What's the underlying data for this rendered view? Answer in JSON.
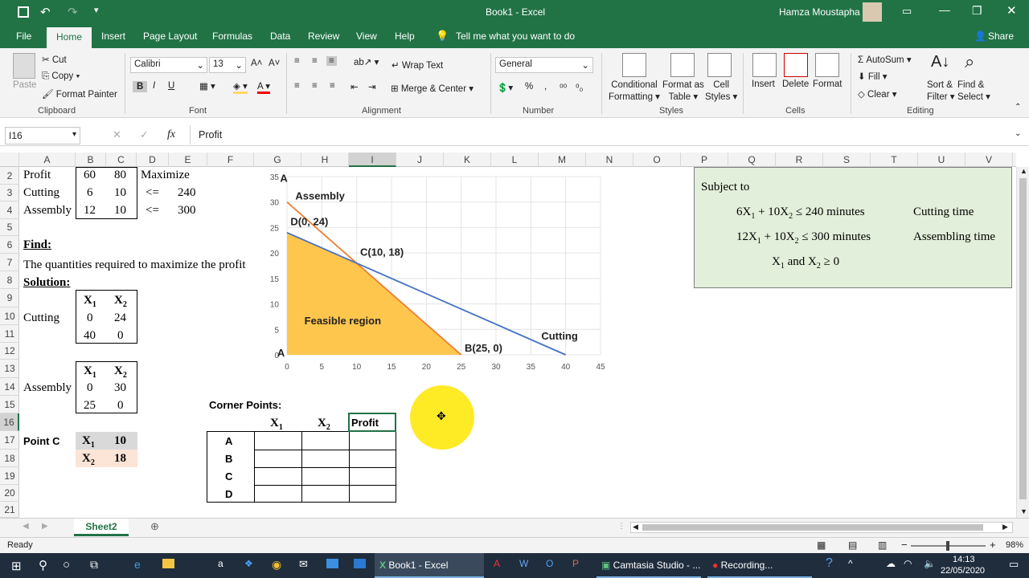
{
  "titlebar": {
    "title": "Book1  -  Excel",
    "user": "Hamza Moustapha"
  },
  "tabs": [
    "File",
    "Home",
    "Insert",
    "Page Layout",
    "Formulas",
    "Data",
    "Review",
    "View",
    "Help"
  ],
  "tell_me": "Tell me what you want to do",
  "share": "Share",
  "ribbon": {
    "clipboard": {
      "paste": "Paste",
      "cut": "Cut",
      "copy": "Copy",
      "format_painter": "Format Painter",
      "label": "Clipboard"
    },
    "font": {
      "name": "Calibri",
      "size": "13",
      "label": "Font"
    },
    "alignment": {
      "wrap": "Wrap Text",
      "merge": "Merge & Center",
      "label": "Alignment"
    },
    "number": {
      "format": "General",
      "label": "Number"
    },
    "styles": {
      "cond": "Conditional",
      "cond2": "Formatting",
      "fmt_table": "Format as",
      "fmt_table2": "Table",
      "cell_styles": "Cell",
      "cell_styles2": "Styles",
      "label": "Styles"
    },
    "cells": {
      "insert": "Insert",
      "delete": "Delete",
      "format": "Format",
      "label": "Cells"
    },
    "editing": {
      "autosum": "AutoSum",
      "fill": "Fill",
      "clear": "Clear",
      "sort": "Sort &",
      "sort2": "Filter",
      "find": "Find &",
      "find2": "Select",
      "label": "Editing"
    }
  },
  "formula_bar": {
    "name_box": "I16",
    "fx": "fx",
    "content": "Profit"
  },
  "columns": [
    "A",
    "B",
    "C",
    "D",
    "E",
    "F",
    "G",
    "H",
    "I",
    "J",
    "K",
    "L",
    "M",
    "N",
    "O",
    "P",
    "Q",
    "R",
    "S",
    "T",
    "U",
    "V"
  ],
  "rows": [
    "2",
    "3",
    "4",
    "5",
    "6",
    "7",
    "8",
    "9",
    "10",
    "11",
    "12",
    "13",
    "14",
    "15",
    "16",
    "17",
    "18",
    "19",
    "20",
    "21"
  ],
  "cells": {
    "a2": "Profit",
    "b2": "60",
    "c2": "80",
    "d2": "Maximize",
    "a3": "Cutting",
    "b3": "6",
    "c3": "10",
    "d3": "<=",
    "e3": "240",
    "a4": "Assembly",
    "b4": "12",
    "c4": "10",
    "d4": "<=",
    "e4": "300",
    "a6": "Find:",
    "a7": "The quantities required to maximize the profit",
    "a8": "Solution:",
    "b9": "X1",
    "c9": "X2",
    "a10": "Cutting",
    "b10": "0",
    "c10": "24",
    "b11": "40",
    "c11": "0",
    "b13": "X1",
    "c13": "X2",
    "a14": "Assembly",
    "b14": "0",
    "c14": "30",
    "b15": "25",
    "c15": "0",
    "f15": "Corner Points:",
    "g16": "X1",
    "h16": "X2",
    "i16": "Profit",
    "a17": "Point C",
    "b17": "X1",
    "c17": "10",
    "b18": "X2",
    "c18": "18",
    "f17": "A",
    "f18": "B",
    "f19": "C",
    "f20": "D"
  },
  "textbox": {
    "subject": "Subject to",
    "line1": "6X1 + 10X2 ≤ 240 minutes",
    "line1_label": "Cutting time",
    "line2": "12X1 + 10X2 ≤ 300 minutes",
    "line2_label": "Assembling time",
    "line3": "X1 and X2 ≥ 0"
  },
  "chart_data": {
    "type": "area",
    "title": "",
    "xlabel": "",
    "ylabel": "",
    "xlim": [
      0,
      45
    ],
    "ylim": [
      0,
      35
    ],
    "xticks": [
      "0",
      "5",
      "10",
      "15",
      "20",
      "25",
      "30",
      "35",
      "40",
      "45"
    ],
    "yticks": [
      "0",
      "5",
      "10",
      "15",
      "20",
      "25",
      "30",
      "35"
    ],
    "series": [
      {
        "name": "Assembly",
        "x": [
          0,
          25
        ],
        "y": [
          30,
          0
        ],
        "color": "#ED7D31"
      },
      {
        "name": "Cutting",
        "x": [
          0,
          40
        ],
        "y": [
          24,
          0
        ],
        "color": "#4472C4"
      }
    ],
    "feasible_region": {
      "x": [
        0,
        0,
        10,
        25
      ],
      "y": [
        0,
        24,
        18,
        0
      ],
      "color": "#FFC64D"
    },
    "annotations": [
      "A",
      "Assembly",
      "D(0, 24)",
      "C(10, 18)",
      "Feasible region",
      "Cutting",
      "B(25, 0)",
      "A"
    ],
    "grid": true
  },
  "sheet": {
    "tab": "Sheet2"
  },
  "status": {
    "ready": "Ready",
    "zoom": "98%"
  },
  "taskbar": {
    "excel": "Book1 - Excel",
    "camtasia": "Camtasia Studio - ...",
    "recording": "Recording...",
    "time": "14:13",
    "date": "22/05/2020"
  }
}
